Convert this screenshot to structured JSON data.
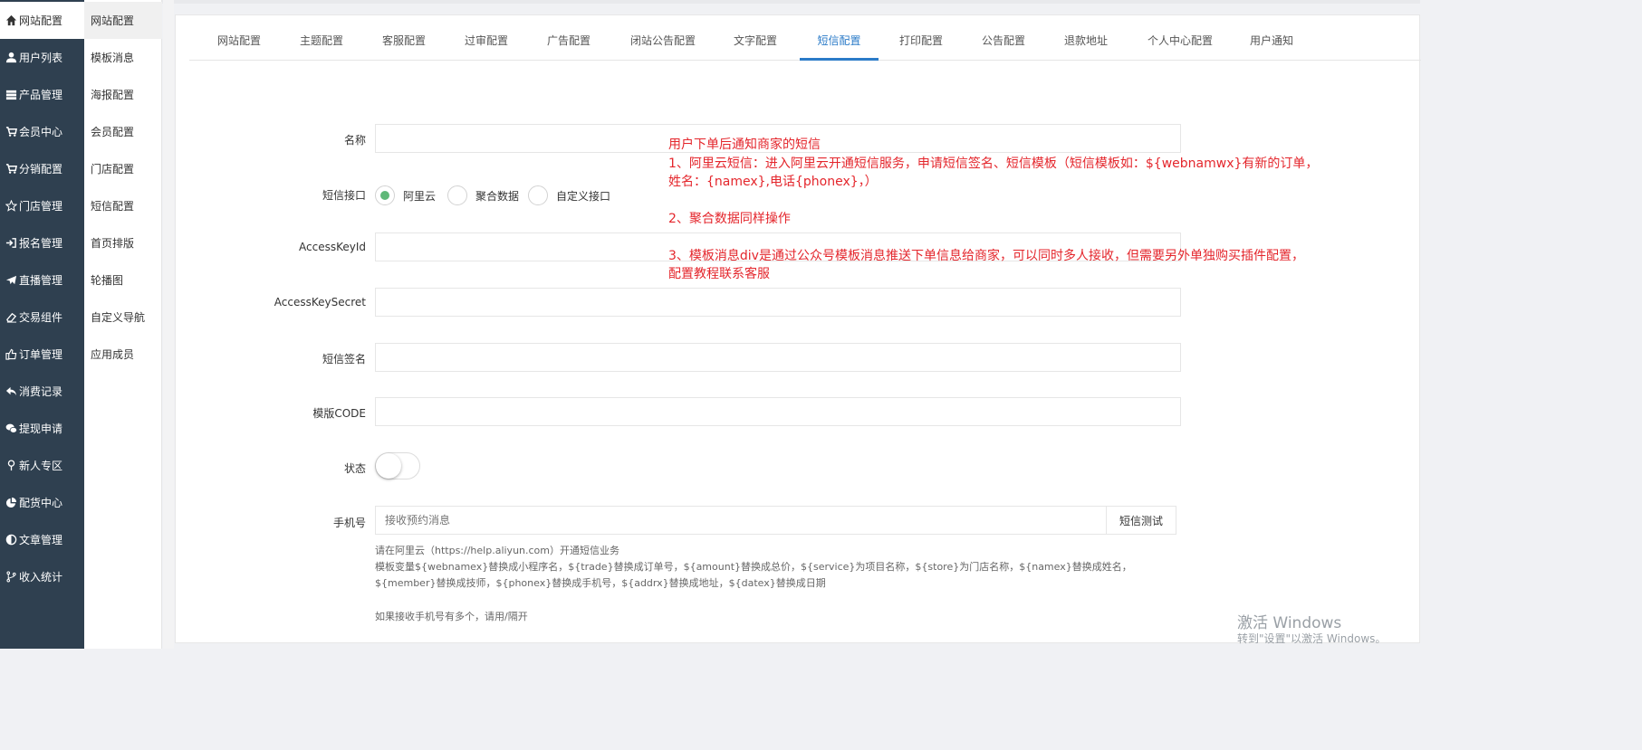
{
  "sidebar": {
    "items": [
      {
        "label": "网站配置",
        "icon": "home-icon"
      },
      {
        "label": "用户列表",
        "icon": "user-icon"
      },
      {
        "label": "产品管理",
        "icon": "server-icon"
      },
      {
        "label": "会员中心",
        "icon": "cart-icon"
      },
      {
        "label": "分销配置",
        "icon": "cart-icon"
      },
      {
        "label": "门店管理",
        "icon": "star-icon"
      },
      {
        "label": "报名管理",
        "icon": "sign-in-icon"
      },
      {
        "label": "直播管理",
        "icon": "plane-icon"
      },
      {
        "label": "交易组件",
        "icon": "eraser-icon"
      },
      {
        "label": "订单管理",
        "icon": "thumbs-up-icon"
      },
      {
        "label": "消费记录",
        "icon": "reply-icon"
      },
      {
        "label": "提现申请",
        "icon": "wechat-icon"
      },
      {
        "label": "新人专区",
        "icon": "map-pin-icon"
      },
      {
        "label": "配货中心",
        "icon": "pie-chart-icon"
      },
      {
        "label": "文章管理",
        "icon": "adjust-icon"
      },
      {
        "label": "收入统计",
        "icon": "code-fork-icon"
      }
    ]
  },
  "submenu": {
    "items": [
      "网站配置",
      "模板消息",
      "海报配置",
      "会员配置",
      "门店配置",
      "短信配置",
      "首页排版",
      "轮播图",
      "自定义导航",
      "应用成员"
    ]
  },
  "tabs": [
    "网站配置",
    "主题配置",
    "客服配置",
    "过审配置",
    "广告配置",
    "闭站公告配置",
    "文字配置",
    "短信配置",
    "打印配置",
    "公告配置",
    "退款地址",
    "个人中心配置",
    "用户通知"
  ],
  "form": {
    "name_label": "名称",
    "name_value": "",
    "sms_api_label": "短信接口",
    "sms_api_options": [
      "阿里云",
      "聚合数据",
      "自定义接口"
    ],
    "sms_api_selected": "阿里云",
    "access_key_id_label": "AccessKeyId",
    "access_key_secret_label": "AccessKeySecret",
    "sms_sign_label": "短信签名",
    "template_code_label": "模版CODE",
    "status_label": "状态",
    "status_on": false,
    "phone_label": "手机号",
    "phone_placeholder": "接收预约消息",
    "sms_test_button": "短信测试",
    "help_line1": "请在阿里云（https://help.aliyun.com）开通短信业务",
    "help_line2": "模板变量${webnamex}替换成小程序名，${trade}替换成订单号，${amount}替换成总价，${service}为项目名称，${store}为门店名称，${namex}替换成姓名，",
    "help_line3": "${member}替换成技师，${phonex}替换成手机号，${addrx}替换成地址，${datex}替换成日期",
    "help_multi": "如果接收手机号有多个，请用/隔开"
  },
  "note": {
    "line1": "用户下单后通知商家的短信",
    "line2": "1、阿里云短信：进入阿里云开通短信服务，申请短信签名、短信模板（短信模板如：${webnamwx}有新的订单，",
    "line3": "姓名：{namex},电话{phonex}，）",
    "line4": "2、聚合数据同样操作",
    "line5": "3、模板消息div是通过公众号模板消息推送下单信息给商家，可以同时多人接收，但需要另外单独购买插件配置，",
    "line6": "配置教程联系客服"
  },
  "watermark": {
    "title": "激活 Windows",
    "subtitle": "转到\"设置\"以激活 Windows。"
  },
  "colors": {
    "sidebar_bg": "#2f4050",
    "accent": "#2b7bc8",
    "radio_checked": "#5fb878",
    "note_red": "#e4262c"
  }
}
